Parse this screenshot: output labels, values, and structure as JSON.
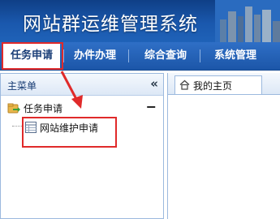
{
  "app": {
    "title": "网站群运维管理系统"
  },
  "nav": {
    "items": [
      {
        "label": "任务申请",
        "active": true
      },
      {
        "label": "办件办理",
        "active": false
      },
      {
        "label": "综合查询",
        "active": false
      },
      {
        "label": "系统管理",
        "active": false
      }
    ]
  },
  "sidebar": {
    "header": "主菜单",
    "collapse_icon": "double-chevron-left-icon",
    "group": {
      "label": "任务申请",
      "icon": "folder-arrow-icon",
      "toggle_icon": "minus-icon"
    },
    "items": [
      {
        "label": "网站维护申请",
        "icon": "form-icon"
      }
    ]
  },
  "main": {
    "tabs": [
      {
        "label": "我的主页",
        "icon": "home-icon"
      }
    ]
  },
  "colors": {
    "header_blue": "#1a58ad",
    "nav_blue": "#2f6fc6",
    "annotation_red": "#e02a2a",
    "border_blue": "#9cb9de"
  }
}
